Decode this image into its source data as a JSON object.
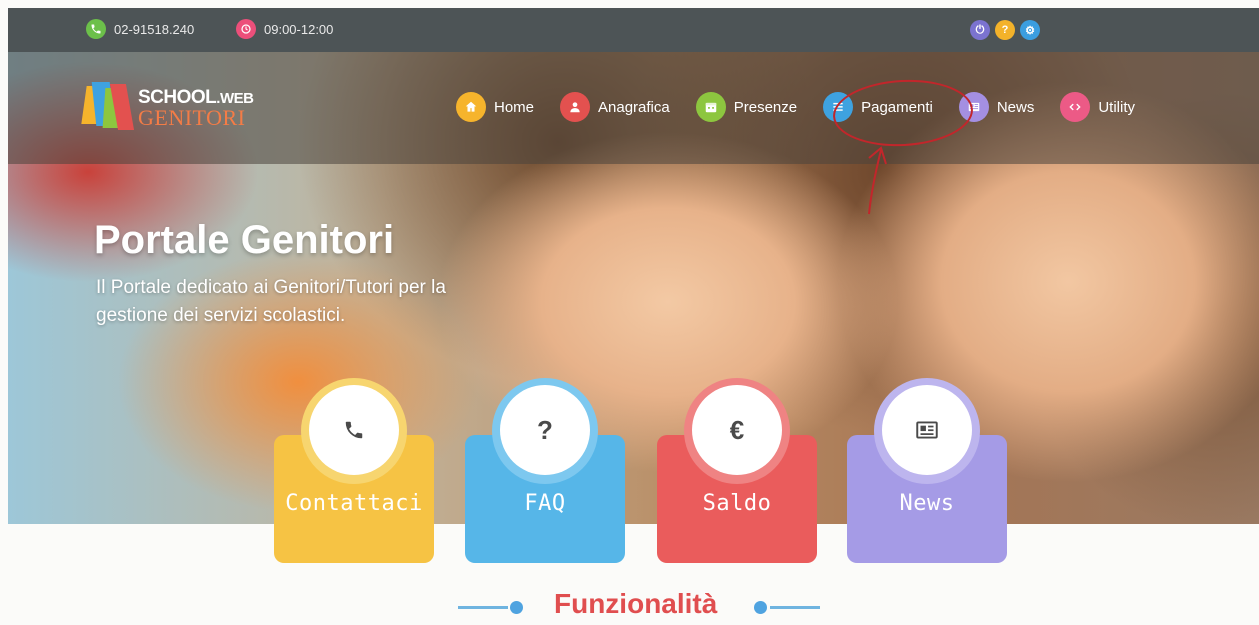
{
  "topbar": {
    "phone": "02-91518.240",
    "hours": "09:00-12:00",
    "right_icons": [
      {
        "name": "power-icon",
        "glyph": "⏻",
        "color": "#7b73d0"
      },
      {
        "name": "help-icon",
        "glyph": "?",
        "color": "#f3b22a"
      },
      {
        "name": "settings-icon",
        "glyph": "⚙",
        "color": "#3b9ee0"
      }
    ]
  },
  "logo": {
    "line1": "SCHOOL",
    "line1_suffix": ".WEB",
    "line2": "GENITORI"
  },
  "nav": {
    "items": [
      {
        "label": "Home",
        "icon": "home-icon",
        "color": "#f6b42c"
      },
      {
        "label": "Anagrafica",
        "icon": "user-icon",
        "color": "#e3514f"
      },
      {
        "label": "Presenze",
        "icon": "calendar-icon",
        "color": "#8dc63f"
      },
      {
        "label": "Pagamenti",
        "icon": "list-icon",
        "color": "#3ea2e0"
      },
      {
        "label": "News",
        "icon": "newspaper-icon",
        "color": "#a48fe2"
      },
      {
        "label": "Utility",
        "icon": "link-icon",
        "color": "#ec5a86"
      }
    ]
  },
  "hero": {
    "title": "Portale Genitori",
    "subtitle": "Il Portale dedicato ai Genitori/Tutori per la gestione dei servizi scolastici."
  },
  "cards": [
    {
      "label": "Contattaci",
      "symbol": "✆",
      "color": "#f6c344",
      "ring": "#f7d56f"
    },
    {
      "label": "FAQ",
      "symbol": "?",
      "color": "#56b6e8",
      "ring": "#7dc8ef"
    },
    {
      "label": "Saldo",
      "symbol": "€",
      "color": "#ea5c5c",
      "ring": "#ef8383"
    },
    {
      "label": "News",
      "symbol": "▤",
      "color": "#a59be6",
      "ring": "#bdb5ee"
    }
  ],
  "section": {
    "title": "Funzionalità"
  },
  "colors": {
    "topbar_bg": "#4d5456",
    "accent_red": "#e04e4f",
    "annotation": "#c2262b"
  }
}
